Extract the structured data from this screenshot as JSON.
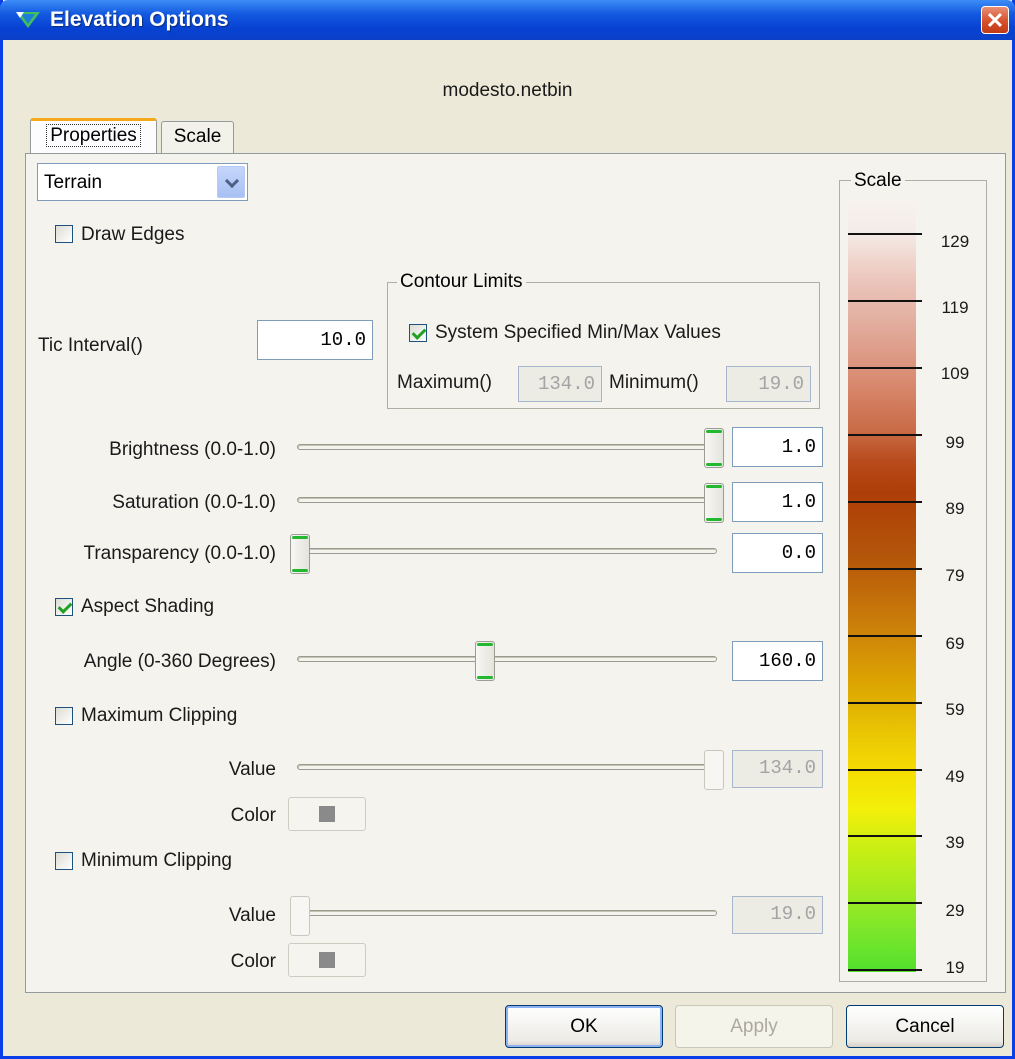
{
  "window": {
    "title": "Elevation Options",
    "close_glyph": "✕"
  },
  "file_name": "modesto.netbin",
  "tabs": [
    {
      "label": "Properties",
      "active": true
    },
    {
      "label": "Scale",
      "active": false
    }
  ],
  "properties": {
    "mode_dropdown": {
      "value": "Terrain"
    },
    "draw_edges": {
      "label": "Draw Edges",
      "checked": false
    },
    "tic_interval": {
      "label": "Tic Interval()",
      "value": "10.0"
    },
    "contour_limits": {
      "title": "Contour Limits",
      "system_specified": {
        "label": "System Specified Min/Max Values",
        "checked": true
      },
      "maximum_label": "Maximum()",
      "maximum_value": "134.0",
      "minimum_label": "Minimum()",
      "minimum_value": "19.0"
    },
    "brightness": {
      "label": "Brightness (0.0-1.0)",
      "value": "1.0",
      "fraction": 1.0
    },
    "saturation": {
      "label": "Saturation (0.0-1.0)",
      "value": "1.0",
      "fraction": 1.0
    },
    "transparency": {
      "label": "Transparency (0.0-1.0)",
      "value": "0.0",
      "fraction": 0.0
    },
    "aspect_shading": {
      "label": "Aspect Shading",
      "checked": true
    },
    "angle": {
      "label": "Angle (0-360 Degrees)",
      "value": "160.0",
      "fraction": 0.444
    },
    "maximum_clipping": {
      "label": "Maximum Clipping",
      "checked": false,
      "value_label": "Value",
      "value": "134.0",
      "color_label": "Color"
    },
    "minimum_clipping": {
      "label": "Minimum Clipping",
      "checked": false,
      "value_label": "Value",
      "value": "19.0",
      "color_label": "Color"
    }
  },
  "scale": {
    "title": "Scale",
    "ticks": [
      "129",
      "119",
      "109",
      "99",
      "89",
      "79",
      "69",
      "59",
      "49",
      "39",
      "29",
      "19"
    ]
  },
  "buttons": {
    "ok": "OK",
    "apply": "Apply",
    "cancel": "Cancel"
  },
  "colors": {
    "title_bar": "#0a47d6",
    "tab_accent": "#f4a81c",
    "check": "#21a121",
    "clip_color": "#8a8a8a"
  }
}
